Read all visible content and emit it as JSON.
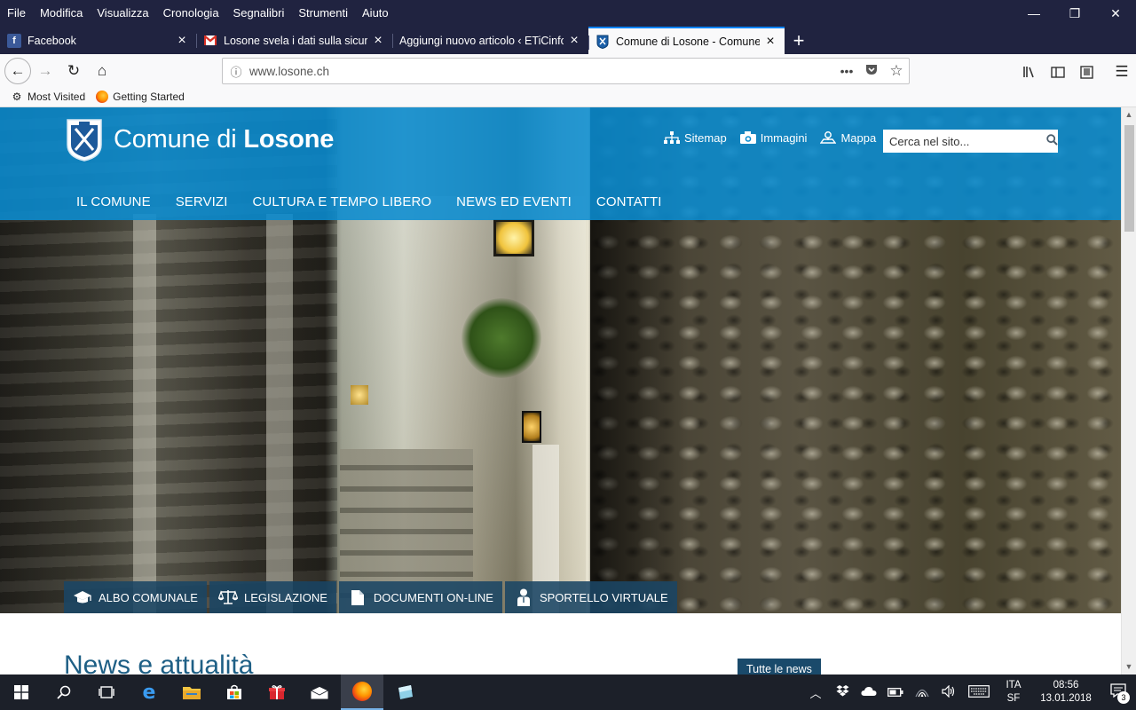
{
  "menubar": {
    "items": [
      "File",
      "Modifica",
      "Visualizza",
      "Cronologia",
      "Segnalibri",
      "Strumenti",
      "Aiuto"
    ]
  },
  "window_controls": {
    "minimize": "—",
    "restore": "❐",
    "close": "✕"
  },
  "tabs": [
    {
      "title": "Facebook",
      "favicon": "facebook-icon",
      "active": false
    },
    {
      "title": "Losone svela i dati sulla sicurezz",
      "favicon": "gmail-icon",
      "active": false
    },
    {
      "title": "Aggiungi nuovo articolo ‹ ETiCinfo",
      "favicon": "none",
      "active": false
    },
    {
      "title": "Comune di Losone - Comune di",
      "favicon": "losone-crest-icon",
      "active": true
    }
  ],
  "navbar": {
    "url": "www.losone.ch",
    "back_icon": "←",
    "forward_icon": "→",
    "reload_icon": "↻",
    "home_icon": "⌂",
    "page_actions_icon": "•••",
    "pocket_icon": "◗",
    "bookmark_icon": "☆"
  },
  "bookmarks": [
    {
      "label": "Most Visited",
      "icon": "gear-icon"
    },
    {
      "label": "Getting Started",
      "icon": "firefox-icon"
    }
  ],
  "site": {
    "title_prefix": "Comune di ",
    "title_bold": "Losone",
    "utility_links": [
      {
        "label": "Sitemap",
        "icon": "sitemap-icon"
      },
      {
        "label": "Immagini",
        "icon": "camera-icon"
      },
      {
        "label": "Mappa",
        "icon": "map-icon"
      }
    ],
    "search_placeholder": "Cerca nel sito...",
    "nav": [
      "IL COMUNE",
      "SERVIZI",
      "CULTURA E TEMPO LIBERO",
      "NEWS ED EVENTI",
      "CONTATTI"
    ],
    "quick_links": [
      {
        "label": "ALBO COMUNALE",
        "icon": "mortarboard-icon"
      },
      {
        "label": "LEGISLAZIONE",
        "icon": "scales-icon"
      },
      {
        "label": "DOCUMENTI ON-LINE",
        "icon": "document-icon"
      },
      {
        "label": "SPORTELLO VIRTUALE",
        "icon": "person-icon"
      }
    ],
    "news_title": "News e attualità",
    "all_news": "Tutte le news"
  },
  "taskbar": {
    "lang_top": "ITA",
    "lang_bottom": "SF",
    "time": "08:56",
    "date": "13.01.2018",
    "notification_count": "3"
  },
  "colors": {
    "header_blue": "#0a8cd0",
    "nav_dark": "#1a4664",
    "title_blue": "#1e5f85",
    "chrome_dark": "#202340",
    "tab_accent": "#0a84ff"
  }
}
